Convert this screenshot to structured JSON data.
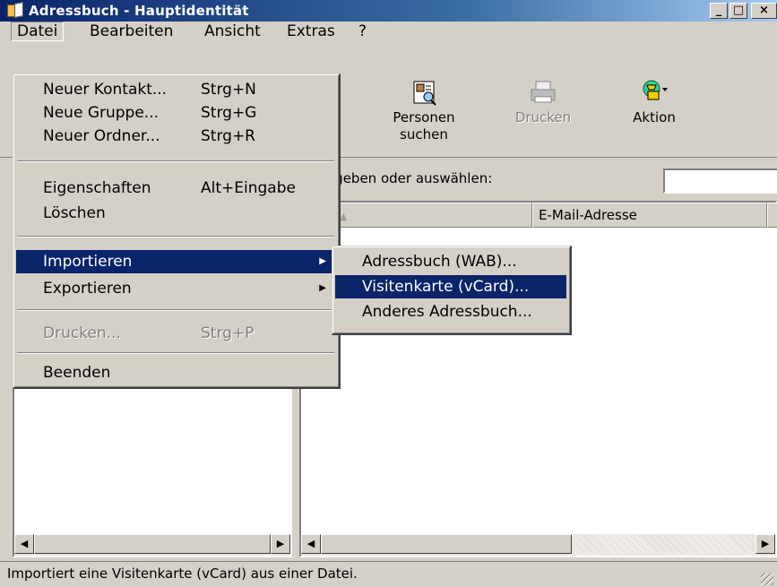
{
  "window": {
    "title": "Adressbuch - Hauptidentität",
    "controls": [
      "_",
      "□",
      "×"
    ]
  },
  "menubar": [
    "Datei",
    "Bearbeiten",
    "Ansicht",
    "Extras",
    "?"
  ],
  "toolbar": {
    "personen_suchen": "Personen\nsuchen",
    "personen_line1": "Personen",
    "personen_line2": "suchen",
    "drucken": "Drucken",
    "aktion": "Aktion"
  },
  "search": {
    "label": "n eingeben oder auswählen:",
    "value": ""
  },
  "columns": {
    "name_partial": "e",
    "sort_indicator": "▲",
    "email": "E-Mail-Adresse"
  },
  "datei_menu": [
    {
      "label": "Neuer Kontakt...",
      "shortcut": "Strg+N"
    },
    {
      "label": "Neue Gruppe...",
      "shortcut": "Strg+G"
    },
    {
      "label": "Neuer Ordner...",
      "shortcut": "Strg+R"
    },
    {
      "label": "Eigenschaften",
      "shortcut": "Alt+Eingabe"
    },
    {
      "label": "Löschen",
      "shortcut": ""
    },
    {
      "label": "Importieren",
      "shortcut": "",
      "submenu": true,
      "highlighted": true
    },
    {
      "label": "Exportieren",
      "shortcut": "",
      "submenu": true
    },
    {
      "label": "Drucken...",
      "shortcut": "Strg+P",
      "disabled": true
    },
    {
      "label": "Beenden",
      "shortcut": ""
    }
  ],
  "import_submenu": [
    {
      "label": "Adressbuch (WAB)..."
    },
    {
      "label": "Visitenkarte (vCard)...",
      "highlighted": true
    },
    {
      "label": "Anderes Adressbuch..."
    }
  ],
  "statusbar": {
    "text": "Importiert eine Visitenkarte (vCard) aus einer Datei."
  },
  "colors": {
    "titlebar_start": "#0a246a",
    "titlebar_end": "#a6caf0",
    "highlight": "#0a246a",
    "face": "#d4d0c8"
  }
}
